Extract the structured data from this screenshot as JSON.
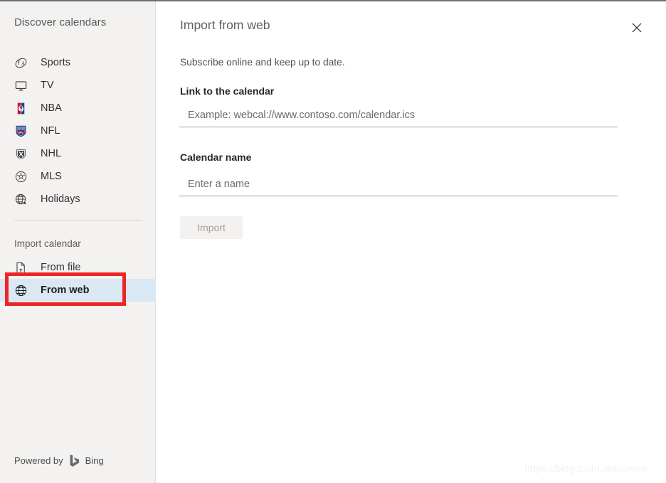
{
  "sidebar": {
    "title": "Discover calendars",
    "items": [
      {
        "label": "Sports",
        "icon": "baseball-icon"
      },
      {
        "label": "TV",
        "icon": "tv-monitor-icon"
      },
      {
        "label": "NBA",
        "icon": "nba-logo-icon"
      },
      {
        "label": "NFL",
        "icon": "nfl-logo-icon"
      },
      {
        "label": "NHL",
        "icon": "nhl-logo-icon"
      },
      {
        "label": "MLS",
        "icon": "soccer-ball-icon"
      },
      {
        "label": "Holidays",
        "icon": "globe-star-icon"
      }
    ],
    "import_section_label": "Import calendar",
    "import_items": [
      {
        "label": "From file",
        "icon": "file-upload-icon",
        "selected": false
      },
      {
        "label": "From web",
        "icon": "globe-icon",
        "selected": true
      }
    ],
    "footer": {
      "powered_by": "Powered by",
      "brand": "Bing",
      "logo_icon": "bing-logo-icon"
    }
  },
  "main": {
    "title": "Import from web",
    "close_icon": "close-icon",
    "subtitle": "Subscribe online and keep up to date.",
    "fields": [
      {
        "label": "Link to the calendar",
        "placeholder": "Example: webcal://www.contoso.com/calendar.ics",
        "value": ""
      },
      {
        "label": "Calendar name",
        "placeholder": "Enter a name",
        "value": ""
      }
    ],
    "submit_label": "Import"
  },
  "watermark": "https://blog.csdn.net/xovee",
  "colors": {
    "accent_highlight": "#d9e8f3",
    "annotation_red": "#ef2525",
    "sidebar_bg": "#f3f2f1",
    "disabled_button_bg": "#f3f2f1",
    "disabled_button_text": "#a19f9d"
  }
}
